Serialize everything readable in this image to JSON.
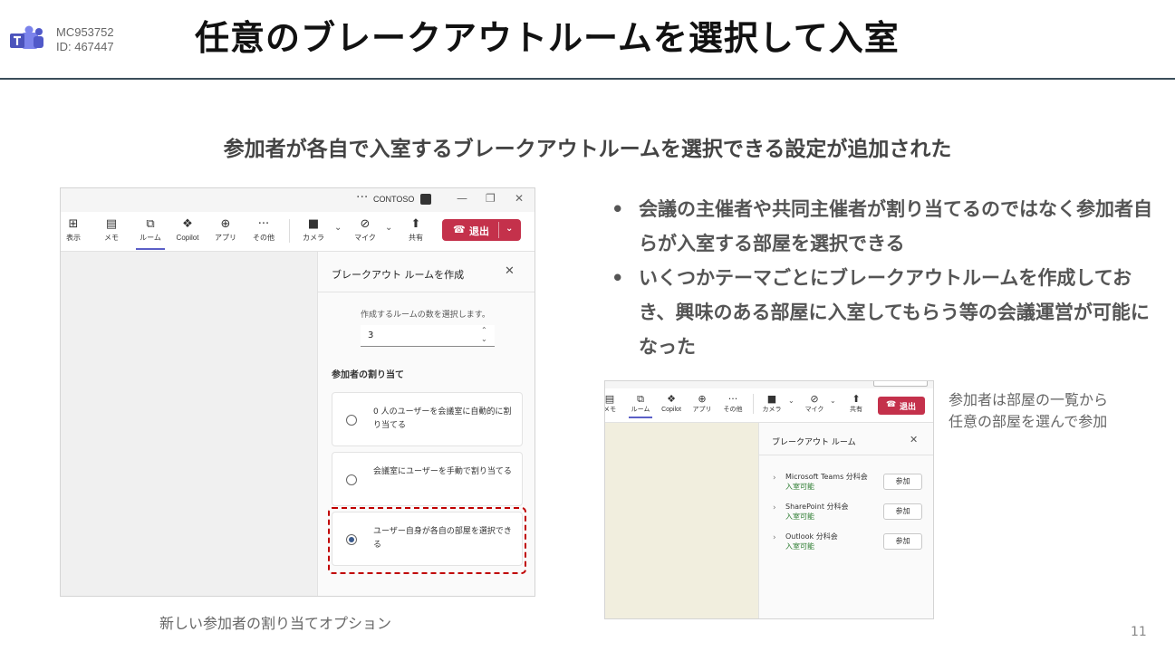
{
  "header": {
    "logo_icon": "teams-logo-icon",
    "meta_code": "MC953752",
    "meta_id": "ID: 467447",
    "title": "任意のブレークアウトルームを選択して入室",
    "accent_color": "#3a4e5a"
  },
  "subtitle": "参加者が各自で入室するブレークアウトルームを選択できる設定が追加された",
  "screenshot_left": {
    "titlebar": {
      "more": "···",
      "org": "CONTOSO",
      "minimize": "—",
      "restore": "❐",
      "close": "✕"
    },
    "toolbar": [
      {
        "label": "表示",
        "icon": "grid-icon"
      },
      {
        "label": "メモ",
        "icon": "notes-icon"
      },
      {
        "label": "ルーム",
        "icon": "rooms-icon",
        "active": true
      },
      {
        "label": "Copilot",
        "icon": "copilot-icon"
      },
      {
        "label": "アプリ",
        "icon": "apps-icon"
      },
      {
        "label": "その他",
        "icon": "more-icon"
      },
      {
        "label": "カメラ",
        "icon": "camera-off-icon"
      },
      {
        "label": "マイク",
        "icon": "mic-off-icon"
      },
      {
        "label": "共有",
        "icon": "share-icon"
      }
    ],
    "leave_label": "退出",
    "leave_color": "#c4314b",
    "panel": {
      "title": "ブレークアウト ルームを作成",
      "room_count_label": "作成するルームの数を選択します。",
      "room_count_value": "3",
      "assign_heading": "参加者の割り当て",
      "options": [
        {
          "text": "0 人のユーザーを会議室に自動的に割り当てる",
          "selected": false
        },
        {
          "text": "会議室にユーザーを手動で割り当てる",
          "selected": false
        },
        {
          "text": "ユーザー自身が各自の部屋を選択できる",
          "selected": true
        }
      ]
    },
    "highlight_color": "#c00000"
  },
  "caption_left": "新しい参加者の割り当てオプション",
  "bullets": [
    "会議の主催者や共同主催者が割り当てるのではなく参加者自らが入室する部屋を選択できる",
    "いくつかテーマごとにブレークアウトルームを作成しておき、興味のある部屋に入室してもらう等の会議運営が可能になった"
  ],
  "screenshot_right": {
    "toolbar": [
      {
        "label": "メモ",
        "icon": "notes-icon"
      },
      {
        "label": "ルーム",
        "icon": "rooms-icon",
        "active": true
      },
      {
        "label": "Copilot",
        "icon": "copilot-icon"
      },
      {
        "label": "アプリ",
        "icon": "apps-icon"
      },
      {
        "label": "その他",
        "icon": "more-icon"
      },
      {
        "label": "カメラ",
        "icon": "camera-off-icon"
      },
      {
        "label": "マイク",
        "icon": "mic-off-icon"
      },
      {
        "label": "共有",
        "icon": "share-icon"
      }
    ],
    "leave_label": "退出",
    "panel": {
      "title": "ブレークアウト ルーム",
      "rooms": [
        {
          "name": "Microsoft Teams 分科会",
          "status": "入室可能",
          "join": "参加"
        },
        {
          "name": "SharePoint 分科会",
          "status": "入室可能",
          "join": "参加"
        },
        {
          "name": "Outlook 分科会",
          "status": "入室可能",
          "join": "参加"
        }
      ]
    }
  },
  "caption_right": [
    "参加者は部屋の一覧から",
    "任意の部屋を選んで参加"
  ],
  "page_number": "11"
}
